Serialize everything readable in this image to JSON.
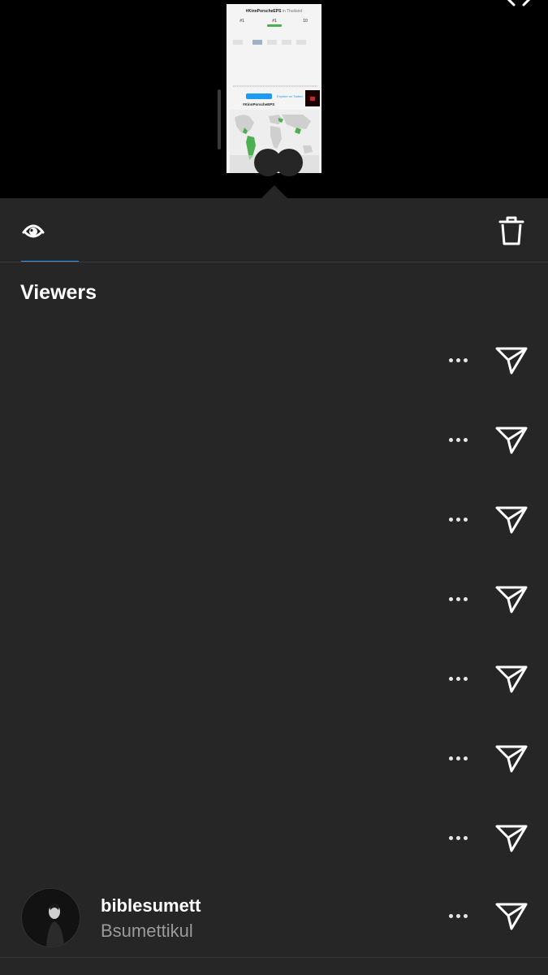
{
  "preview": {
    "title": "#KinnPorscheEPS",
    "title_suffix": "in Thailand",
    "stat_rank_1": "#1",
    "stat_rank_2": "#1",
    "stat_rank_3": "10",
    "tweet_label": "Tweet",
    "explore_label": "Explore on Twitter",
    "map_title": "#KinnPorscheEPS",
    "map_title_suffix": "in Other Locations"
  },
  "tabs": {
    "active": "views",
    "icons": [
      "eye-icon",
      "trash-icon"
    ]
  },
  "section": {
    "title": "Viewers"
  },
  "viewers": [
    {
      "username": "",
      "full_name": ""
    },
    {
      "username": "",
      "full_name": ""
    },
    {
      "username": "",
      "full_name": ""
    },
    {
      "username": "",
      "full_name": ""
    },
    {
      "username": "",
      "full_name": ""
    },
    {
      "username": "",
      "full_name": ""
    },
    {
      "username": "",
      "full_name": ""
    },
    {
      "username": "biblesumett",
      "full_name": "Bsumettikul"
    }
  ],
  "colors": {
    "background": "#262626",
    "top_area": "#000000",
    "accent_underline": "#3897f0",
    "secondary_text": "#9a9a9a"
  }
}
